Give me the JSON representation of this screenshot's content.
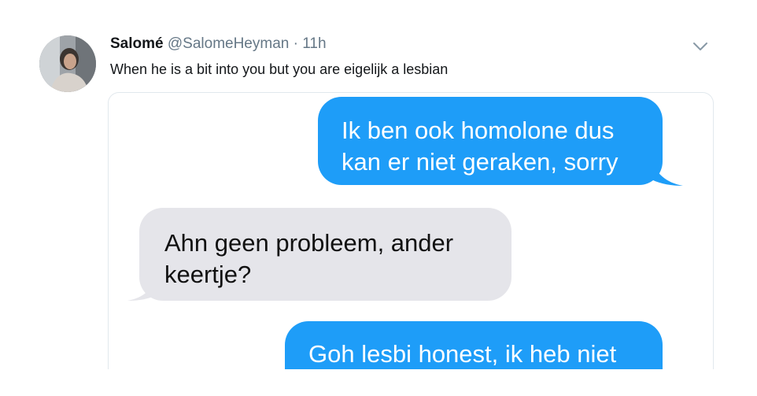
{
  "tweet": {
    "author_name": "Salomé",
    "author_handle": "@SalomeHeyman",
    "separator": "·",
    "time": "11h",
    "text": "When he is a bit into you but you are eigelijk a lesbian"
  },
  "media": {
    "messages": [
      {
        "direction": "sent",
        "lines": [
          "Ik ben ook homolone dus",
          "kan er niet geraken, sorry"
        ]
      },
      {
        "direction": "received",
        "lines": [
          "Ahn geen probleem, ander",
          "keertje?"
        ]
      },
      {
        "direction": "sent",
        "lines": [
          "Goh lesbi honest, ik heb niet"
        ]
      }
    ]
  },
  "colors": {
    "sent_bubble": "#1e9df8",
    "received_bubble": "#e5e5ea",
    "muted_text": "#657786"
  },
  "icons": {
    "caret": "chevron-down-icon"
  }
}
